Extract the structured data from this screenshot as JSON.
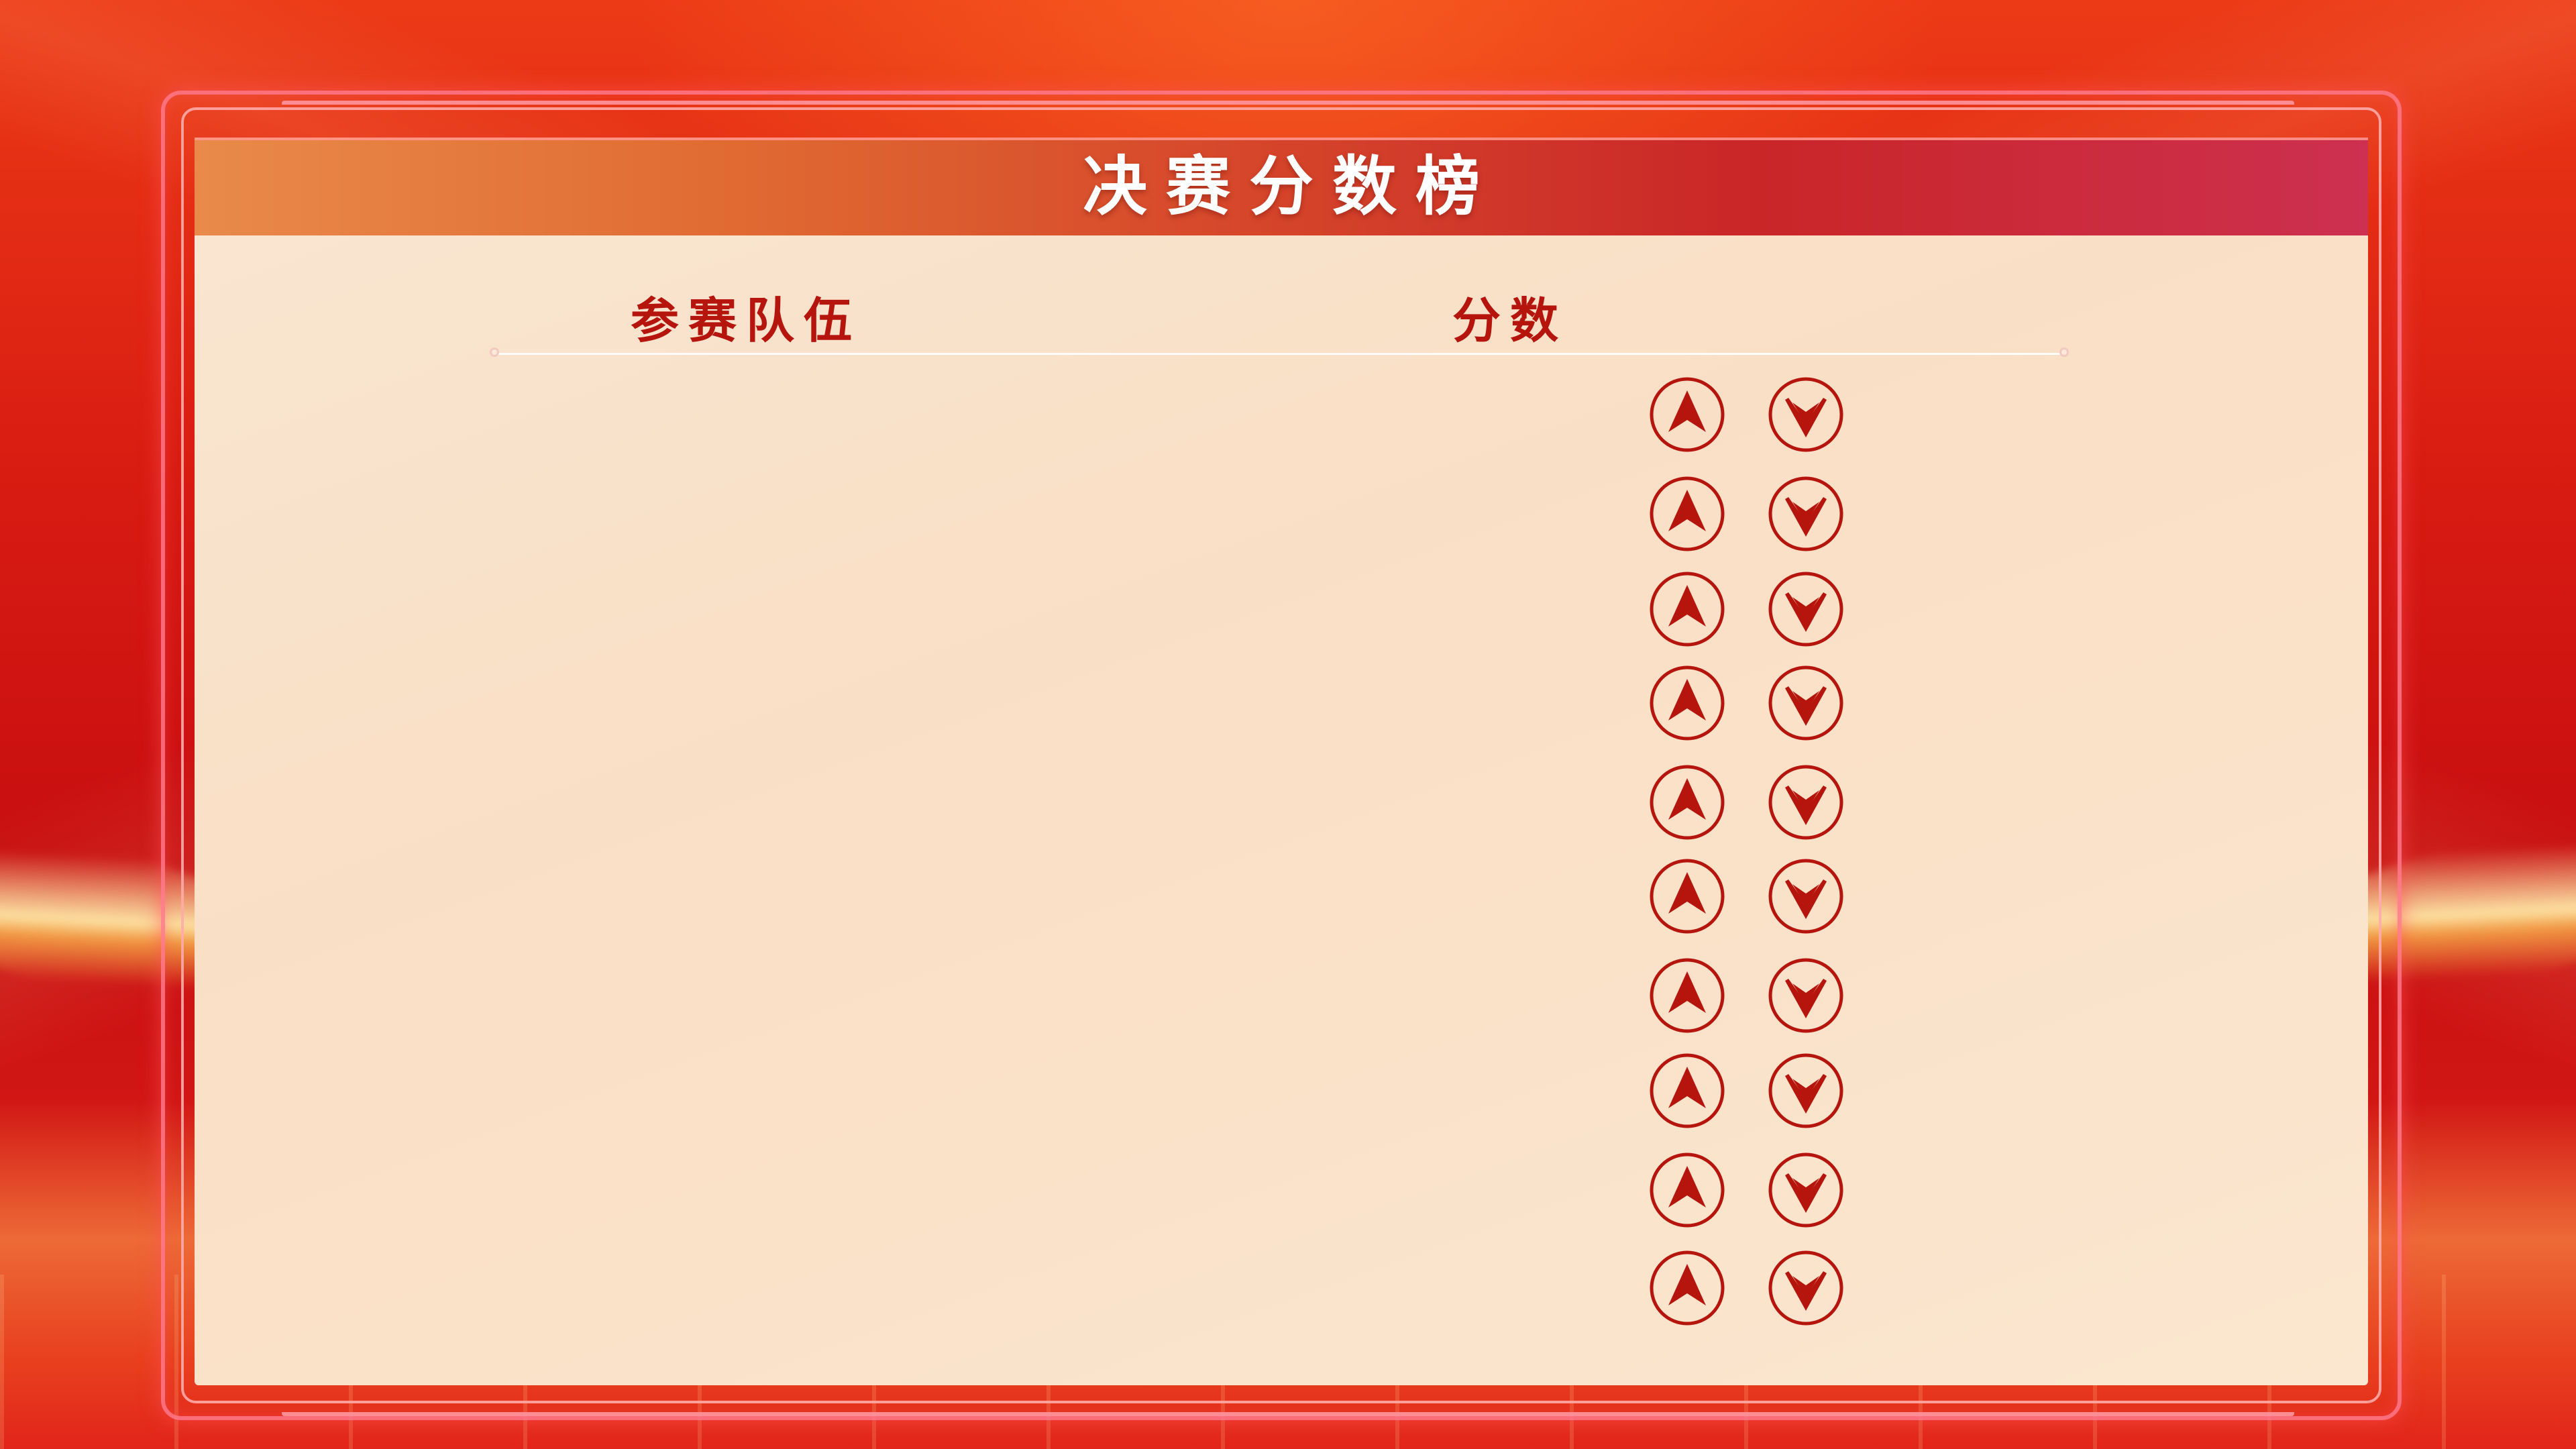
{
  "title": "决赛分数榜",
  "columns": {
    "team": "参赛队伍",
    "score": "分数"
  },
  "rows": [
    {
      "team": "",
      "score": "",
      "up_icon": "arrow-up-circle-icon",
      "down_icon": "chevron-down-circle-icon"
    },
    {
      "team": "",
      "score": "",
      "up_icon": "arrow-up-circle-icon",
      "down_icon": "chevron-down-circle-icon"
    },
    {
      "team": "",
      "score": "",
      "up_icon": "arrow-up-circle-icon",
      "down_icon": "chevron-down-circle-icon"
    },
    {
      "team": "",
      "score": "",
      "up_icon": "arrow-up-circle-icon",
      "down_icon": "chevron-down-circle-icon"
    },
    {
      "team": "",
      "score": "",
      "up_icon": "arrow-up-circle-icon",
      "down_icon": "chevron-down-circle-icon"
    },
    {
      "team": "",
      "score": "",
      "up_icon": "arrow-up-circle-icon",
      "down_icon": "chevron-down-circle-icon"
    },
    {
      "team": "",
      "score": "",
      "up_icon": "arrow-up-circle-icon",
      "down_icon": "chevron-down-circle-icon"
    },
    {
      "team": "",
      "score": "",
      "up_icon": "arrow-up-circle-icon",
      "down_icon": "chevron-down-circle-icon"
    },
    {
      "team": "",
      "score": "",
      "up_icon": "arrow-up-circle-icon",
      "down_icon": "chevron-down-circle-icon"
    },
    {
      "team": "",
      "score": "",
      "up_icon": "arrow-up-circle-icon",
      "down_icon": "chevron-down-circle-icon"
    }
  ],
  "colors": {
    "accent": "#b6150d",
    "panel": "#f9e1c9",
    "title_gradient_start": "#e98a4a",
    "title_gradient_end": "#cd3050",
    "background": "#d81b14"
  }
}
